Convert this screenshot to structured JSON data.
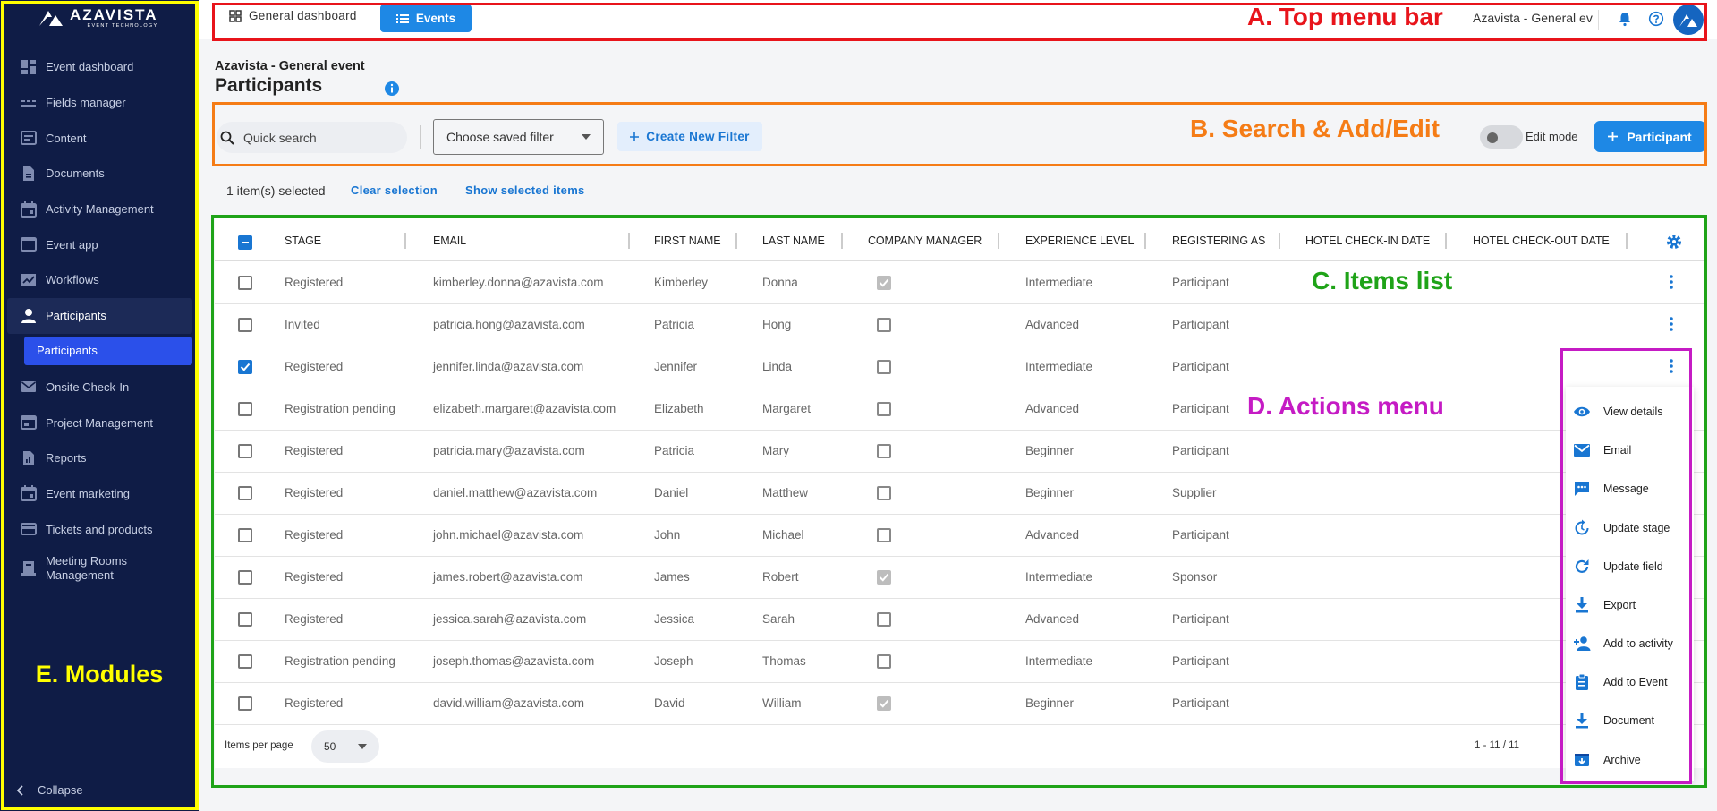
{
  "brand": {
    "name": "AZAVISTA",
    "tagline": "EVENT TECHNOLOGY"
  },
  "sidebar": {
    "items": [
      {
        "label": "Event dashboard",
        "icon": "dashboard-icon"
      },
      {
        "label": "Fields manager",
        "icon": "fields-icon"
      },
      {
        "label": "Content",
        "icon": "content-icon"
      },
      {
        "label": "Documents",
        "icon": "document-icon"
      },
      {
        "label": "Activity Management",
        "icon": "calendar-icon"
      },
      {
        "label": "Event app",
        "icon": "app-icon"
      },
      {
        "label": "Workflows",
        "icon": "workflow-icon"
      },
      {
        "label": "Participants",
        "icon": "person-icon",
        "active": true
      },
      {
        "label": "Onsite Check-In",
        "icon": "mail-icon"
      },
      {
        "label": "Project Management",
        "icon": "project-icon"
      },
      {
        "label": "Reports",
        "icon": "report-icon"
      },
      {
        "label": "Event marketing",
        "icon": "calendar-icon"
      },
      {
        "label": "Tickets and products",
        "icon": "card-icon"
      },
      {
        "label": "Meeting Rooms Management",
        "icon": "room-icon"
      }
    ],
    "sub_item": "Participants",
    "collapse_label": "Collapse",
    "annotation": "E. Modules"
  },
  "topbar": {
    "general_dashboard": "General dashboard",
    "events": "Events",
    "annotation": "A. Top menu bar",
    "search_value": "Azavista - General event"
  },
  "header": {
    "event_name": "Azavista - General event",
    "title": "Participants"
  },
  "toolbar": {
    "search_placeholder": "Quick search",
    "saved_filter": "Choose saved filter",
    "create_filter": "Create New Filter",
    "annotation": "B. Search & Add/Edit",
    "edit_mode": "Edit mode",
    "add_participant": "Participant"
  },
  "selection": {
    "count": "1 item(s) selected",
    "clear": "Clear selection",
    "show": "Show selected items"
  },
  "table": {
    "annotation": "C. Items list",
    "columns": [
      "STAGE",
      "EMAIL",
      "FIRST NAME",
      "LAST NAME",
      "COMPANY MANAGER",
      "EXPERIENCE LEVEL",
      "REGISTERING AS",
      "HOTEL CHECK-IN DATE",
      "HOTEL CHECK-OUT DATE"
    ],
    "rows": [
      {
        "stage": "Registered",
        "email": "kimberley.donna@azavista.com",
        "first": "Kimberley",
        "last": "Donna",
        "manager": true,
        "level": "Intermediate",
        "as": "Participant",
        "selected": false
      },
      {
        "stage": "Invited",
        "email": "patricia.hong@azavista.com",
        "first": "Patricia",
        "last": "Hong",
        "manager": false,
        "level": "Advanced",
        "as": "Participant",
        "selected": false
      },
      {
        "stage": "Registered",
        "email": "jennifer.linda@azavista.com",
        "first": "Jennifer",
        "last": "Linda",
        "manager": false,
        "level": "Intermediate",
        "as": "Participant",
        "selected": true
      },
      {
        "stage": "Registration pending",
        "email": "elizabeth.margaret@azavista.com",
        "first": "Elizabeth",
        "last": "Margaret",
        "manager": false,
        "level": "Advanced",
        "as": "Participant",
        "selected": false
      },
      {
        "stage": "Registered",
        "email": "patricia.mary@azavista.com",
        "first": "Patricia",
        "last": "Mary",
        "manager": false,
        "level": "Beginner",
        "as": "Participant",
        "selected": false
      },
      {
        "stage": "Registered",
        "email": "daniel.matthew@azavista.com",
        "first": "Daniel",
        "last": "Matthew",
        "manager": false,
        "level": "Beginner",
        "as": "Supplier",
        "selected": false
      },
      {
        "stage": "Registered",
        "email": "john.michael@azavista.com",
        "first": "John",
        "last": "Michael",
        "manager": false,
        "level": "Advanced",
        "as": "Participant",
        "selected": false
      },
      {
        "stage": "Registered",
        "email": "james.robert@azavista.com",
        "first": "James",
        "last": "Robert",
        "manager": true,
        "level": "Intermediate",
        "as": "Sponsor",
        "selected": false
      },
      {
        "stage": "Registered",
        "email": "jessica.sarah@azavista.com",
        "first": "Jessica",
        "last": "Sarah",
        "manager": false,
        "level": "Advanced",
        "as": "Participant",
        "selected": false
      },
      {
        "stage": "Registration pending",
        "email": "joseph.thomas@azavista.com",
        "first": "Joseph",
        "last": "Thomas",
        "manager": false,
        "level": "Intermediate",
        "as": "Participant",
        "selected": false
      },
      {
        "stage": "Registered",
        "email": "david.william@azavista.com",
        "first": "David",
        "last": "William",
        "manager": true,
        "level": "Beginner",
        "as": "Participant",
        "selected": false
      }
    ],
    "items_per_page_label": "Items per page",
    "items_per_page": "50",
    "range": "1 - 11 / 11"
  },
  "actions_menu": {
    "annotation": "D. Actions menu",
    "items": [
      {
        "label": "View details",
        "icon": "eye-icon"
      },
      {
        "label": "Email",
        "icon": "email-icon"
      },
      {
        "label": "Message",
        "icon": "message-icon"
      },
      {
        "label": "Update stage",
        "icon": "update-stage-icon"
      },
      {
        "label": "Update field",
        "icon": "refresh-icon"
      },
      {
        "label": "Export",
        "icon": "download-icon"
      },
      {
        "label": "Add to activity",
        "icon": "add-person-icon"
      },
      {
        "label": "Add to Event",
        "icon": "clipboard-icon"
      },
      {
        "label": "Document",
        "icon": "download-icon"
      },
      {
        "label": "Archive",
        "icon": "archive-icon"
      }
    ]
  },
  "colors": {
    "sidebar_bg": "#0f1c46",
    "accent": "#1e88e5",
    "annotation_red": "#e8141b",
    "annotation_orange": "#f57c16",
    "annotation_green": "#1fa318",
    "annotation_magenta": "#c51bc4",
    "annotation_yellow": "#ffff00"
  }
}
